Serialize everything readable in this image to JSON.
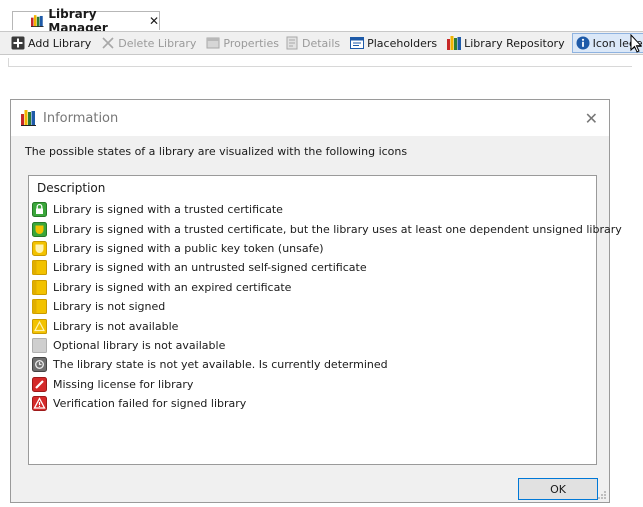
{
  "library_manager": {
    "tab_title": "Library Manager",
    "tab_close": "✕",
    "toolbar": [
      {
        "key": "add",
        "label": "Add Library",
        "icon": "add-library-icon",
        "enabled": true
      },
      {
        "key": "delete",
        "label": "Delete Library",
        "icon": "delete-icon",
        "enabled": false
      },
      {
        "key": "properties",
        "label": "Properties",
        "icon": "properties-icon",
        "enabled": false
      },
      {
        "key": "details",
        "label": "Details",
        "icon": "details-icon",
        "enabled": false
      },
      {
        "key": "placeholders",
        "label": "Placeholders",
        "icon": "placeholders-icon",
        "enabled": true
      },
      {
        "key": "repository",
        "label": "Library Repository",
        "icon": "library-repository-icon",
        "enabled": true
      },
      {
        "key": "legend",
        "label": "Icon legend...",
        "icon": "info-icon",
        "enabled": true
      }
    ]
  },
  "dialog": {
    "title": "Information",
    "intro": "The possible states of a library are visualized with the following icons",
    "column_header": "Description",
    "ok_label": "OK",
    "items": [
      {
        "icon": "trusted-certificate-icon",
        "text": "Library is signed with a trusted certificate"
      },
      {
        "icon": "trusted-unsigned-dependency-icon",
        "text": "Library is signed with a trusted certificate, but the library uses at least one dependent unsigned library"
      },
      {
        "icon": "public-key-token-icon",
        "text": "Library is signed with a public key token (unsafe)"
      },
      {
        "icon": "untrusted-self-signed-icon",
        "text": "Library is signed with an untrusted self-signed certificate"
      },
      {
        "icon": "expired-certificate-icon",
        "text": "Library is signed with an expired certificate"
      },
      {
        "icon": "not-signed-icon",
        "text": "Library is not signed"
      },
      {
        "icon": "not-available-icon",
        "text": "Library is not available"
      },
      {
        "icon": "optional-not-available-icon",
        "text": "Optional library is not available"
      },
      {
        "icon": "state-pending-icon",
        "text": "The library state is not yet available. Is currently determined"
      },
      {
        "icon": "missing-license-icon",
        "text": "Missing license for library"
      },
      {
        "icon": "verification-failed-icon",
        "text": "Verification failed for signed library"
      }
    ]
  },
  "colors": {
    "library_books": [
      "#c62828",
      "#f2b400",
      "#2e7d32",
      "#1e5aa8"
    ],
    "state_yellow": "#f2c200",
    "state_green": "#3aa63a",
    "state_red": "#d42a2a",
    "state_gray": "#bdbdbd",
    "accent_blue": "#0078d7"
  }
}
